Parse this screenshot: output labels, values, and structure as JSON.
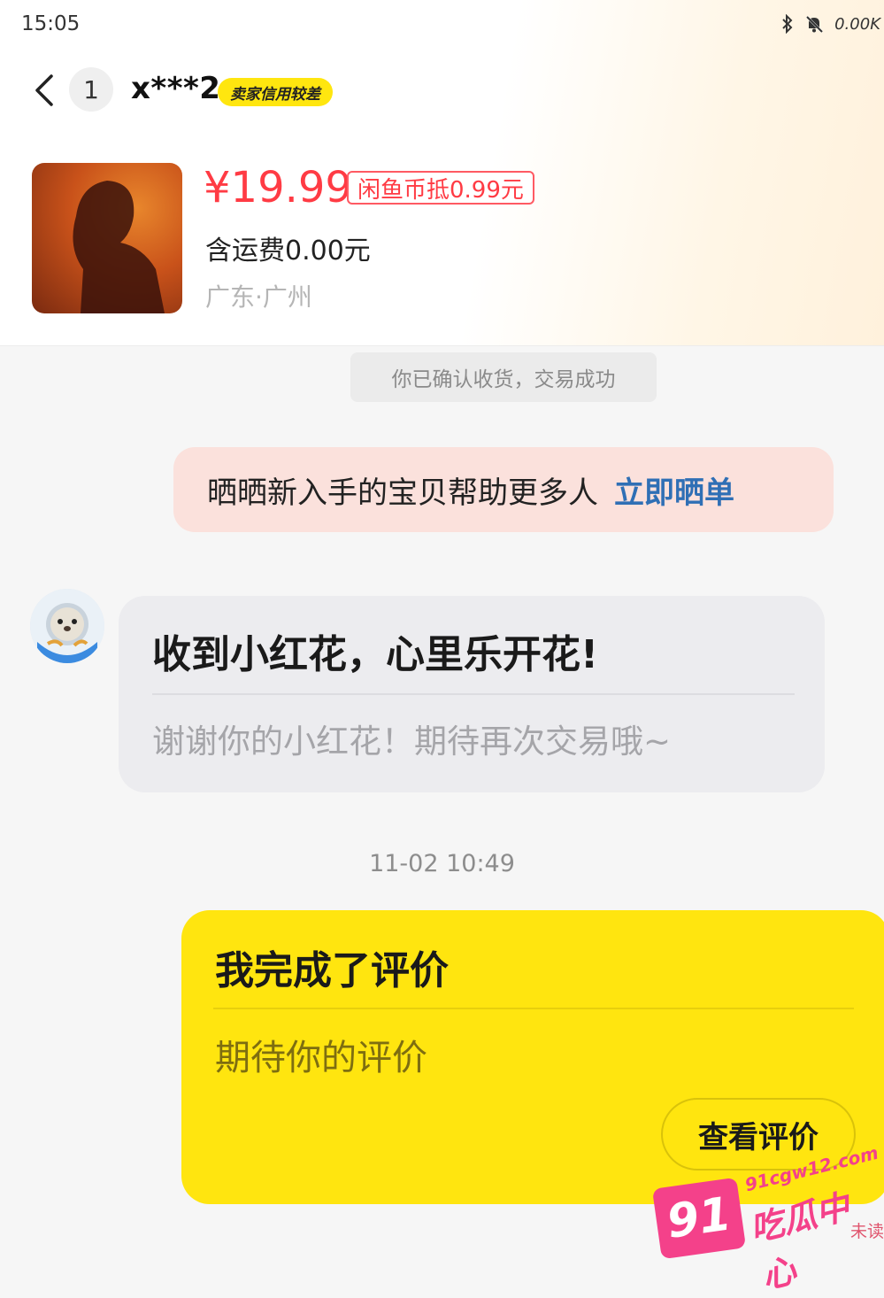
{
  "status_bar": {
    "time": "15:05",
    "speed": "0.00K"
  },
  "header": {
    "unread_count": "1",
    "user_name": "x***2",
    "credit_badge": "卖家信用较差"
  },
  "item": {
    "price": "¥19.99",
    "coin_tag": "闲鱼币抵0.99元",
    "shipping": "含运费0.00元",
    "location": "广东·广州"
  },
  "chat": {
    "system_tip": "你已确认收货，交易成功",
    "promo": {
      "text": "晒晒新入手的宝贝帮助更多人",
      "link": "立即晒单"
    },
    "seller_card": {
      "title": "收到小红花，心里乐开花!",
      "subtitle": "谢谢你的小红花！期待再次交易哦~"
    },
    "timestamp": "11-02 10:49",
    "my_card": {
      "title": "我完成了评价",
      "subtitle": "期待你的评价",
      "button": "查看评价"
    }
  },
  "watermark": {
    "number": "91",
    "url": "91cgw12.com",
    "name": "吃瓜中心",
    "unread": "未读"
  }
}
